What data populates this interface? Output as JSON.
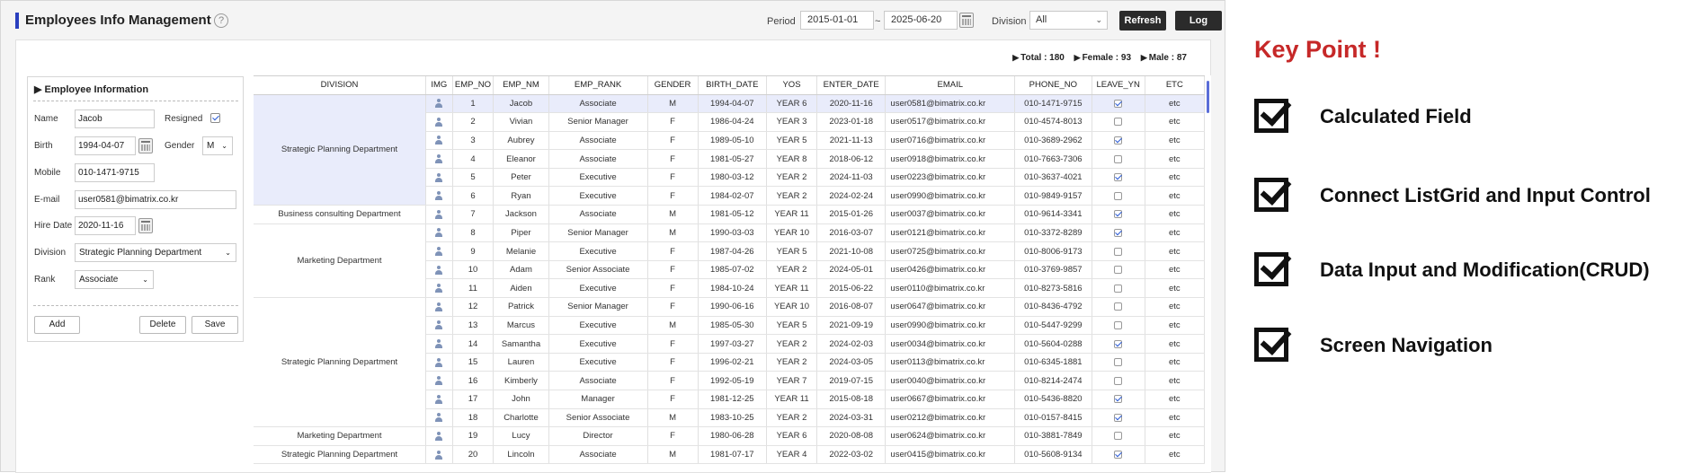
{
  "header": {
    "title": "Employees Info Management",
    "help_glyph": "?",
    "period_label": "Period",
    "date_from": "2015-01-01",
    "date_sep": "~",
    "date_to": "2025-06-20",
    "division_label": "Division",
    "division_value": "All",
    "refresh_label": "Refresh",
    "log_label": "Log"
  },
  "summary": {
    "total": "Total : 180",
    "female": "Female : 93",
    "male": "Male : 87"
  },
  "form": {
    "title": "Employee Information",
    "name_label": "Name",
    "name_value": "Jacob",
    "resigned_label": "Resigned",
    "resigned_checked": true,
    "birth_label": "Birth",
    "birth_value": "1994-04-07",
    "gender_label": "Gender",
    "gender_value": "M",
    "mobile_label": "Mobile",
    "mobile_value": "010-1471-9715",
    "email_label": "E-mail",
    "email_value": "user0581@bimatrix.co.kr",
    "hire_label": "Hire Date",
    "hire_value": "2020-11-16",
    "division_label": "Division",
    "division_value": "Strategic Planning Department",
    "rank_label": "Rank",
    "rank_value": "Associate",
    "add_label": "Add",
    "delete_label": "Delete",
    "save_label": "Save"
  },
  "grid": {
    "columns": [
      "DIVISION",
      "IMG",
      "EMP_NO",
      "EMP_NM",
      "EMP_RANK",
      "GENDER",
      "BIRTH_DATE",
      "YOS",
      "ENTER_DATE",
      "EMAIL",
      "PHONE_NO",
      "LEAVE_YN",
      "ETC"
    ],
    "division_groups": [
      {
        "label": "Strategic Planning Department",
        "rows": 6,
        "selected": true
      },
      {
        "label": "Business consulting Department",
        "rows": 1,
        "selected": false
      },
      {
        "label": "Marketing Department",
        "rows": 4,
        "selected": false
      },
      {
        "label": "Strategic Planning Department",
        "rows": 7,
        "selected": false
      },
      {
        "label": "Marketing Department",
        "rows": 1,
        "selected": false
      },
      {
        "label": "Strategic Planning Department",
        "rows": 1,
        "selected": false
      }
    ],
    "rows": [
      {
        "no": "1",
        "name": "Jacob",
        "rank": "Associate",
        "gender": "M",
        "birth": "1994-04-07",
        "yos": "YEAR 6",
        "enter": "2020-11-16",
        "email": "user0581@bimatrix.co.kr",
        "phone": "010-1471-9715",
        "leave": true,
        "etc": "etc"
      },
      {
        "no": "2",
        "name": "Vivian",
        "rank": "Senior Manager",
        "gender": "F",
        "birth": "1986-04-24",
        "yos": "YEAR 3",
        "enter": "2023-01-18",
        "email": "user0517@bimatrix.co.kr",
        "phone": "010-4574-8013",
        "leave": false,
        "etc": "etc"
      },
      {
        "no": "3",
        "name": "Aubrey",
        "rank": "Associate",
        "gender": "F",
        "birth": "1989-05-10",
        "yos": "YEAR 5",
        "enter": "2021-11-13",
        "email": "user0716@bimatrix.co.kr",
        "phone": "010-3689-2962",
        "leave": true,
        "etc": "etc"
      },
      {
        "no": "4",
        "name": "Eleanor",
        "rank": "Associate",
        "gender": "F",
        "birth": "1981-05-27",
        "yos": "YEAR 8",
        "enter": "2018-06-12",
        "email": "user0918@bimatrix.co.kr",
        "phone": "010-7663-7306",
        "leave": false,
        "etc": "etc"
      },
      {
        "no": "5",
        "name": "Peter",
        "rank": "Executive",
        "gender": "F",
        "birth": "1980-03-12",
        "yos": "YEAR 2",
        "enter": "2024-11-03",
        "email": "user0223@bimatrix.co.kr",
        "phone": "010-3637-4021",
        "leave": true,
        "etc": "etc"
      },
      {
        "no": "6",
        "name": "Ryan",
        "rank": "Executive",
        "gender": "F",
        "birth": "1984-02-07",
        "yos": "YEAR 2",
        "enter": "2024-02-24",
        "email": "user0990@bimatrix.co.kr",
        "phone": "010-9849-9157",
        "leave": false,
        "etc": "etc"
      },
      {
        "no": "7",
        "name": "Jackson",
        "rank": "Associate",
        "gender": "M",
        "birth": "1981-05-12",
        "yos": "YEAR 11",
        "enter": "2015-01-26",
        "email": "user0037@bimatrix.co.kr",
        "phone": "010-9614-3341",
        "leave": true,
        "etc": "etc"
      },
      {
        "no": "8",
        "name": "Piper",
        "rank": "Senior Manager",
        "gender": "M",
        "birth": "1990-03-03",
        "yos": "YEAR 10",
        "enter": "2016-03-07",
        "email": "user0121@bimatrix.co.kr",
        "phone": "010-3372-8289",
        "leave": true,
        "etc": "etc"
      },
      {
        "no": "9",
        "name": "Melanie",
        "rank": "Executive",
        "gender": "F",
        "birth": "1987-04-26",
        "yos": "YEAR 5",
        "enter": "2021-10-08",
        "email": "user0725@bimatrix.co.kr",
        "phone": "010-8006-9173",
        "leave": false,
        "etc": "etc"
      },
      {
        "no": "10",
        "name": "Adam",
        "rank": "Senior Associate",
        "gender": "F",
        "birth": "1985-07-02",
        "yos": "YEAR 2",
        "enter": "2024-05-01",
        "email": "user0426@bimatrix.co.kr",
        "phone": "010-3769-9857",
        "leave": false,
        "etc": "etc"
      },
      {
        "no": "11",
        "name": "Aiden",
        "rank": "Executive",
        "gender": "F",
        "birth": "1984-10-24",
        "yos": "YEAR 11",
        "enter": "2015-06-22",
        "email": "user0110@bimatrix.co.kr",
        "phone": "010-8273-5816",
        "leave": false,
        "etc": "etc"
      },
      {
        "no": "12",
        "name": "Patrick",
        "rank": "Senior Manager",
        "gender": "F",
        "birth": "1990-06-16",
        "yos": "YEAR 10",
        "enter": "2016-08-07",
        "email": "user0647@bimatrix.co.kr",
        "phone": "010-8436-4792",
        "leave": false,
        "etc": "etc"
      },
      {
        "no": "13",
        "name": "Marcus",
        "rank": "Executive",
        "gender": "M",
        "birth": "1985-05-30",
        "yos": "YEAR 5",
        "enter": "2021-09-19",
        "email": "user0990@bimatrix.co.kr",
        "phone": "010-5447-9299",
        "leave": false,
        "etc": "etc"
      },
      {
        "no": "14",
        "name": "Samantha",
        "rank": "Executive",
        "gender": "F",
        "birth": "1997-03-27",
        "yos": "YEAR 2",
        "enter": "2024-02-03",
        "email": "user0034@bimatrix.co.kr",
        "phone": "010-5604-0288",
        "leave": true,
        "etc": "etc"
      },
      {
        "no": "15",
        "name": "Lauren",
        "rank": "Executive",
        "gender": "F",
        "birth": "1996-02-21",
        "yos": "YEAR 2",
        "enter": "2024-03-05",
        "email": "user0113@bimatrix.co.kr",
        "phone": "010-6345-1881",
        "leave": false,
        "etc": "etc"
      },
      {
        "no": "16",
        "name": "Kimberly",
        "rank": "Associate",
        "gender": "F",
        "birth": "1992-05-19",
        "yos": "YEAR 7",
        "enter": "2019-07-15",
        "email": "user0040@bimatrix.co.kr",
        "phone": "010-8214-2474",
        "leave": false,
        "etc": "etc"
      },
      {
        "no": "17",
        "name": "John",
        "rank": "Manager",
        "gender": "F",
        "birth": "1981-12-25",
        "yos": "YEAR 11",
        "enter": "2015-08-18",
        "email": "user0667@bimatrix.co.kr",
        "phone": "010-5436-8820",
        "leave": true,
        "etc": "etc"
      },
      {
        "no": "18",
        "name": "Charlotte",
        "rank": "Senior Associate",
        "gender": "M",
        "birth": "1983-10-25",
        "yos": "YEAR 2",
        "enter": "2024-03-31",
        "email": "user0212@bimatrix.co.kr",
        "phone": "010-0157-8415",
        "leave": true,
        "etc": "etc"
      },
      {
        "no": "19",
        "name": "Lucy",
        "rank": "Director",
        "gender": "F",
        "birth": "1980-06-28",
        "yos": "YEAR 6",
        "enter": "2020-08-08",
        "email": "user0624@bimatrix.co.kr",
        "phone": "010-3881-7849",
        "leave": false,
        "etc": "etc"
      },
      {
        "no": "20",
        "name": "Lincoln",
        "rank": "Associate",
        "gender": "M",
        "birth": "1981-07-17",
        "yos": "YEAR 4",
        "enter": "2022-03-02",
        "email": "user0415@bimatrix.co.kr",
        "phone": "010-5608-9134",
        "leave": true,
        "etc": "etc"
      }
    ]
  },
  "key_points": {
    "title": "Key Point !",
    "items": [
      {
        "label": "Calculated Field"
      },
      {
        "label": "Connect ListGrid and Input Control"
      },
      {
        "label": "Data Input and Modification(CRUD)"
      },
      {
        "label": "Screen Navigation"
      }
    ]
  },
  "colors": {
    "accent": "#2a3fbf",
    "keypoint_title": "#c62828",
    "selected_row": "#e9ecfb",
    "selected_division": "#c9d2f7"
  }
}
